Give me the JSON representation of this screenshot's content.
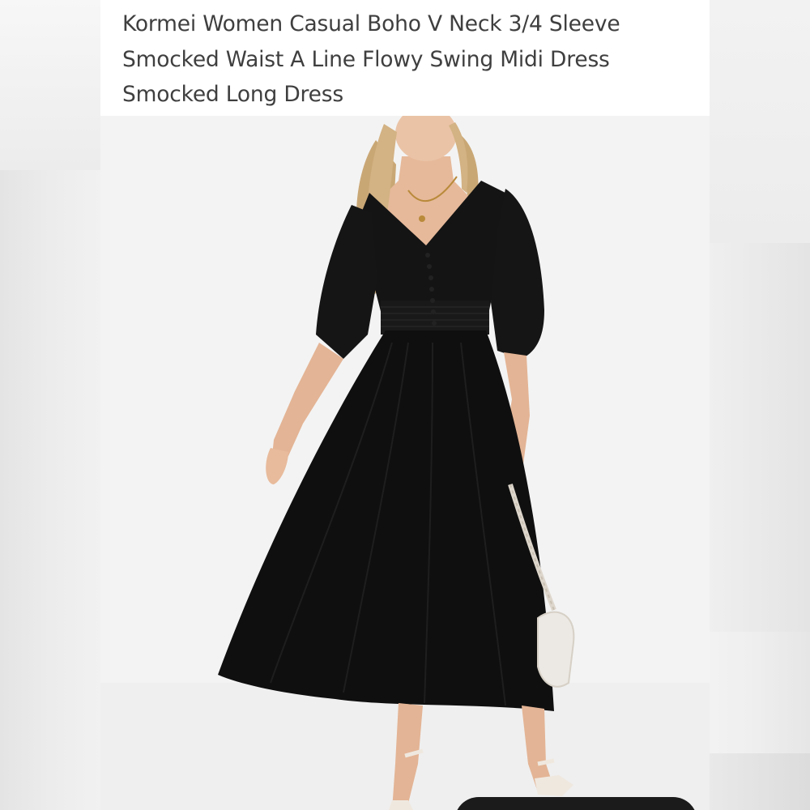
{
  "listing": {
    "title_lines": [
      "Kormei Women Casual Boho V Neck 3/4 Sleeve",
      "Smocked Waist A Line Flowy Swing Midi Dress",
      "Smocked Long Dress"
    ]
  },
  "photo": {
    "subject": "model-wearing-black-midi-dress",
    "dress_color": "#111111",
    "background_color": "#f3f3f3",
    "bag_color": "#ece8e3"
  },
  "colors": {
    "title_text": "#3f3f3f",
    "card_background": "#ffffff",
    "bottom_pill": "#1b1b1b"
  }
}
